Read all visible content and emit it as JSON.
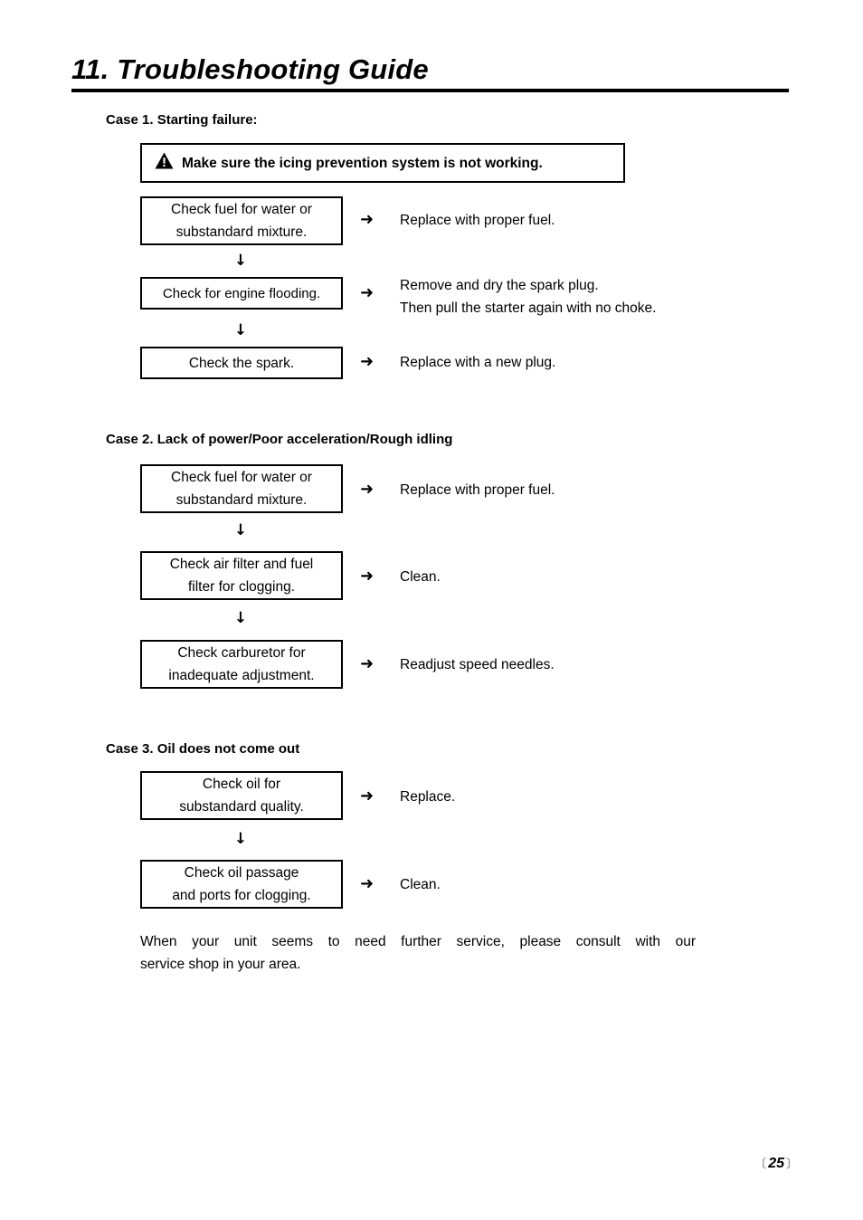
{
  "document": {
    "title": "11. Troubleshooting Guide",
    "page_number": "25",
    "bracket_left": "〔",
    "bracket_right": "〕"
  },
  "warning": {
    "icon": "warning-triangle-icon",
    "text": "Make sure the icing prevention system is not working."
  },
  "icons": {
    "down_arrow": "↓",
    "right_arrow": "➜"
  },
  "cases": [
    {
      "heading": "Case 1. Starting failure:",
      "steps": [
        {
          "box_lines": [
            "Check fuel for water or",
            "substandard mixture."
          ],
          "result_lines": [
            "Replace with proper fuel."
          ]
        },
        {
          "box_lines": [
            "Check for engine flooding."
          ],
          "result_lines": [
            "Remove and dry the spark plug.",
            "Then pull the starter again with no choke."
          ]
        },
        {
          "box_lines": [
            "Check the spark."
          ],
          "result_lines": [
            "Replace with a new plug."
          ]
        }
      ]
    },
    {
      "heading": "Case 2. Lack of power/Poor acceleration/Rough idling",
      "steps": [
        {
          "box_lines": [
            "Check fuel for water or",
            "substandard mixture."
          ],
          "result_lines": [
            "Replace with proper fuel."
          ]
        },
        {
          "box_lines": [
            "Check air filter and fuel",
            "filter for clogging."
          ],
          "result_lines": [
            "Clean."
          ]
        },
        {
          "box_lines": [
            "Check carburetor for",
            "inadequate adjustment."
          ],
          "result_lines": [
            "Readjust speed needles."
          ]
        }
      ]
    },
    {
      "heading": "Case 3. Oil does not come out",
      "steps": [
        {
          "box_lines": [
            "Check oil for",
            "substandard quality."
          ],
          "result_lines": [
            "Replace."
          ]
        },
        {
          "box_lines": [
            "Check oil passage",
            "and ports for clogging."
          ],
          "result_lines": [
            "Clean."
          ]
        }
      ]
    }
  ],
  "closing": {
    "line1": "When your unit seems to need further service, please consult with our",
    "line2": "service shop in your area."
  }
}
